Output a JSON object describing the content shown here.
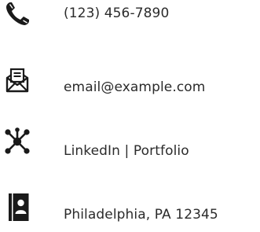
{
  "contact": {
    "phone": {
      "icon": "phone-icon",
      "text": "(123) 456-7890"
    },
    "email": {
      "icon": "envelope-document-icon",
      "text": "email@example.com"
    },
    "links": {
      "icon": "network-icon",
      "text": "LinkedIn | Portfolio"
    },
    "address": {
      "icon": "address-book-icon",
      "text": "Philadelphia, PA 12345"
    }
  },
  "colors": {
    "icon": "#1a1a1a",
    "text": "#2b2b2b",
    "background": "#ffffff"
  }
}
